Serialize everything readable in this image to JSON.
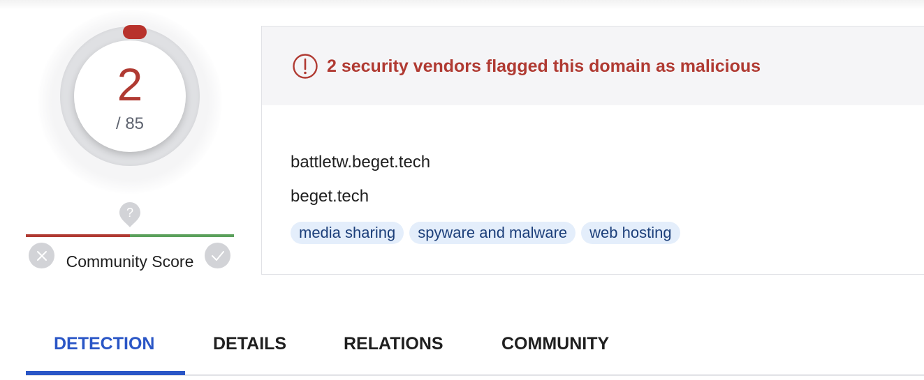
{
  "detection_score": {
    "positives": "2",
    "total": "/ 85",
    "color": "#b03a32"
  },
  "community_score": {
    "label": "Community Score",
    "unknown_icon": "question-marker-icon",
    "harmless_icon": "check-icon",
    "malicious_icon": "x-icon"
  },
  "alert": {
    "icon": "alert-circle-icon",
    "text": "2 security vendors flagged this domain as malicious",
    "color": "#b03a32"
  },
  "domain": {
    "name": "battletw.beget.tech",
    "parent": "beget.tech",
    "tags": [
      "media sharing",
      "spyware and malware",
      "web hosting"
    ]
  },
  "tabs": [
    {
      "label": "DETECTION",
      "active": true
    },
    {
      "label": "DETAILS",
      "active": false
    },
    {
      "label": "RELATIONS",
      "active": false
    },
    {
      "label": "COMMUNITY",
      "active": false
    }
  ],
  "accent_color": "#2a56c6"
}
